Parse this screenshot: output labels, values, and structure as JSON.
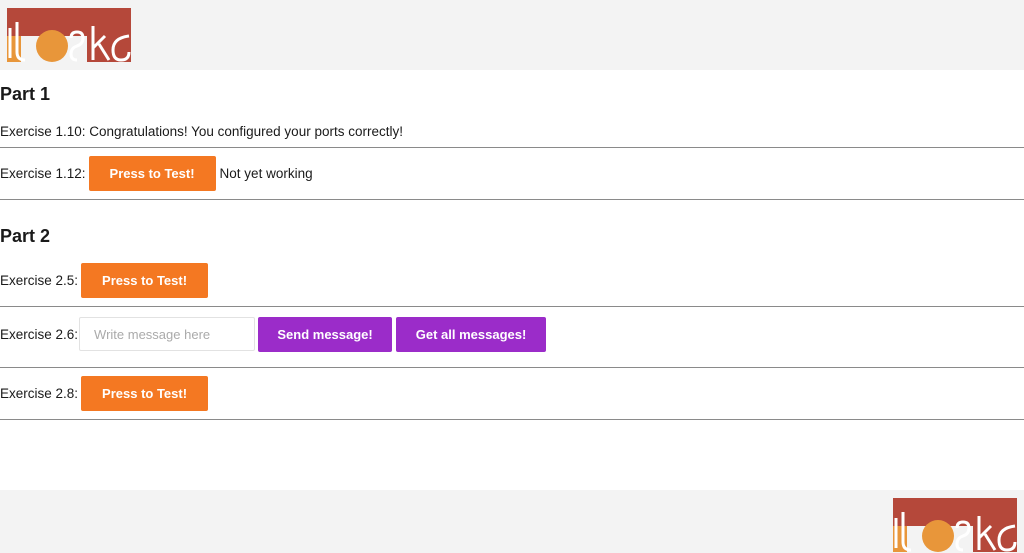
{
  "brand": {
    "logo_text": "itoska",
    "accent": "#f47822",
    "accent_dark": "#b5483a"
  },
  "part1": {
    "heading": "Part 1",
    "ex110_text": "Exercise 1.10: Congratulations! You configured your ports correctly!",
    "ex112_label": "Exercise 1.12:",
    "ex112_button": "Press to Test!",
    "ex112_status": "Not yet working"
  },
  "part2": {
    "heading": "Part 2",
    "ex25_label": "Exercise 2.5:",
    "ex25_button": "Press to Test!",
    "ex26_label": "Exercise 2.6:",
    "ex26_placeholder": "Write message here",
    "ex26_send": "Send message!",
    "ex26_get": "Get all messages!",
    "ex28_label": "Exercise 2.8:",
    "ex28_button": "Press to Test!"
  },
  "colors": {
    "orange_button": "#f47822",
    "purple_button": "#9b2cc9",
    "header_bg": "#f3f3f3"
  }
}
